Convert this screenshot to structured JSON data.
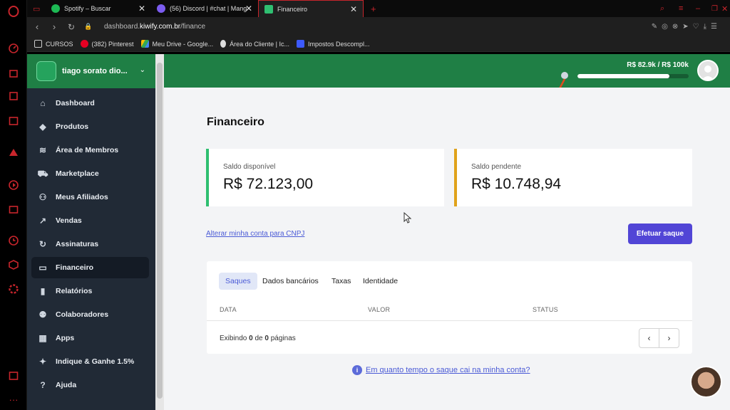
{
  "browser": {
    "tabs": [
      {
        "title": "Spotify – Buscar",
        "active": false
      },
      {
        "title": "(56) Discord | #chat | Mang",
        "active": false
      },
      {
        "title": "Financeiro",
        "active": true
      }
    ],
    "url_prefix": "dashboard.",
    "url_domain": "kiwify.com.br",
    "url_path": "/finance",
    "bookmarks": [
      {
        "label": "CURSOS",
        "icon": "folder-icon"
      },
      {
        "label": "(382) Pinterest",
        "icon": "pinterest-icon"
      },
      {
        "label": "Meu Drive - Google...",
        "icon": "google-drive-icon"
      },
      {
        "label": "Área do Cliente | Ic...",
        "icon": "person-icon"
      },
      {
        "label": "Impostos Descompl...",
        "icon": "bookmark-icon"
      }
    ]
  },
  "account": {
    "name": "tiago sorato dio..."
  },
  "sidebar": {
    "items": [
      {
        "label": "Dashboard",
        "icon": "home-icon"
      },
      {
        "label": "Produtos",
        "icon": "tag-icon"
      },
      {
        "label": "Área de Membros",
        "icon": "graduation-icon"
      },
      {
        "label": "Marketplace",
        "icon": "cart-icon"
      },
      {
        "label": "Meus Afiliados",
        "icon": "users-icon"
      },
      {
        "label": "Vendas",
        "icon": "trend-icon"
      },
      {
        "label": "Assinaturas",
        "icon": "refresh-icon"
      },
      {
        "label": "Financeiro",
        "icon": "card-icon",
        "active": true
      },
      {
        "label": "Relatórios",
        "icon": "bar-chart-icon"
      },
      {
        "label": "Colaboradores",
        "icon": "team-icon"
      },
      {
        "label": "Apps",
        "icon": "apps-icon"
      },
      {
        "label": "Indique & Ganhe 1.5%",
        "icon": "pointer-icon"
      },
      {
        "label": "Ajuda",
        "icon": "help-icon"
      }
    ]
  },
  "header": {
    "goal_text": "R$ 82.9k / R$ 100k",
    "goal_progress": 0.829
  },
  "main": {
    "title": "Financeiro",
    "saldo_disponivel": {
      "label": "Saldo disponível",
      "value": "R$ 72.123,00",
      "color": "#2fbf71"
    },
    "saldo_pendente": {
      "label": "Saldo pendente",
      "value": "R$ 10.748,94",
      "color": "#e0a21b"
    },
    "cnpj_link": "Alterar minha conta para CNPJ",
    "saque_button": "Efetuar saque",
    "tabs": [
      "Saques",
      "Dados bancários",
      "Taxas",
      "Identidade"
    ],
    "columns": [
      "DATA",
      "VALOR",
      "STATUS"
    ],
    "pagination_prefix": "Exibindo ",
    "pagination_from": "0",
    "pagination_mid": " de ",
    "pagination_total": "0",
    "pagination_suffix": " páginas",
    "help_link": "Em quanto tempo o saque cai na minha conta?"
  },
  "colors": {
    "brand_green": "#1f7f45",
    "accent": "#5145d6",
    "sidebar": "#212a36"
  }
}
